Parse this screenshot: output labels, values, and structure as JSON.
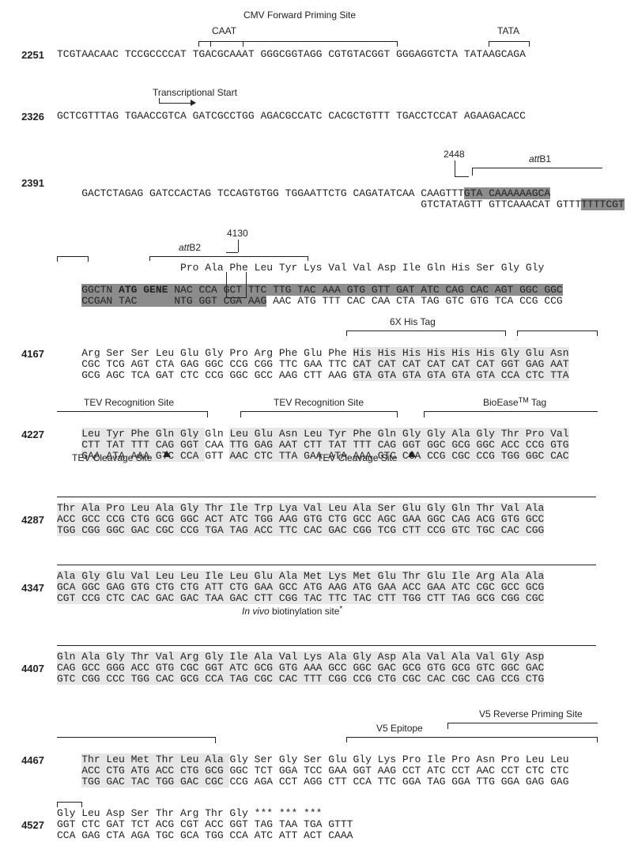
{
  "annotations": {
    "cmv_fwd": "CMV Forward Priming Site",
    "caat": "CAAT",
    "tata": "TATA",
    "tx_start": "Transcriptional Start",
    "attB1": "attB1",
    "attB2": "attB2",
    "pos2448": "2448",
    "pos4130": "4130",
    "atg_gene": "ATG GENE",
    "his_tag": "6X His Tag",
    "tev_rec": "TEV Recognition Site",
    "tev_cleave": "TEV Cleavage Site",
    "bioease": "BioEase",
    "bioease_tm": "TM",
    "bioease_tag": " Tag",
    "in_vivo": "In vivo",
    "in_vivo_rest": " biotinylation site",
    "v5_epitope": "V5 Epitope",
    "v5_rev": "V5 Reverse Priming Site"
  },
  "blocks": [
    {
      "num": "2251",
      "top": "TCGTAACAAC TCCGCCCCAT TGACGCAAAT GGGCGGTAGG CGTGTACGGT GGGAGGTCTA TATAAGCAGA"
    },
    {
      "num": "2326",
      "top": "GCTCGTTTAG TGAACCGTCA GATCGCCTGG AGACGCCATC CACGCTGTTT TGACCTCCAT AGAAGACACC"
    },
    {
      "num": "2391",
      "top": "GACTCTAGAG GATCCACTAG TCCAGTGTGG TGGAATTCTG CAGATATCAA CAAGTTTGTA CAAAAAAGCA",
      "bot": "                                                       GTCTATAGTT GTTCAAACAT GTTTTTTTCGT"
    },
    {
      "num": "",
      "aa": "                    Pro Ala Phe Leu Tyr Lys Val Val Asp Ile Gln His Ser Gly Gly",
      "top": "GGCTN ATG GENE NAC CCA GCT TTC TTG TAC AAA GTG GTT GAT ATC CAG CAC AGT GGC GGC",
      "bot": "CCGAN TAC      NTG GGT CGA AAG AAC ATG TTT CAC CAA CTA TAG GTC GTG TCA CCG CCG"
    },
    {
      "num": "4167",
      "aa": "Arg Ser Ser Leu Glu Gly Pro Arg Phe Glu Phe His His His His His His Gly Glu Asn",
      "top": "CGC TCG AGT CTA GAG GGC CCG CGG TTC GAA TTC CAT CAT CAT CAT CAT CAT GGT GAG AAT",
      "bot": "GCG AGC TCA GAT CTC CCG GGC GCC AAG CTT AAG GTA GTA GTA GTA GTA GTA CCA CTC TTA"
    },
    {
      "num": "4227",
      "aa": "Leu Tyr Phe Gln Gly Gln Leu Glu Asn Leu Tyr Phe Gln Gly Gly Ala Gly Thr Pro Val",
      "top": "CTT TAT TTT CAG GGT CAA TTG GAG AAT CTT TAT TTT CAG GGT GGC GCG GGC ACC CCG GTG",
      "bot": "GAA ATA AAA GTC CCA GTT AAC CTC TTA GAA ATA AAA GTC CCA CCG CGC CCG TGG GGC CAC"
    },
    {
      "num": "4287",
      "aa": "Thr Ala Pro Leu Ala Gly Thr Ile Trp Lya Val Leu Ala Ser Glu Gly Gln Thr Val Ala",
      "top": "ACC GCC CCG CTG GCG GGC ACT ATC TGG AAG GTG CTG GCC AGC GAA GGC CAG ACG GTG GCC",
      "bot": "TGG CGG GGC GAC CGC CCG TGA TAG ACC TTC CAC GAC CGG TCG CTT CCG GTC TGC CAC CGG"
    },
    {
      "num": "4347",
      "aa": "Ala Gly Glu Val Leu Leu Ile Leu Glu Ala Met Lys Met Glu Thr Glu Ile Arg Ala Ala",
      "top": "GCA GGC GAG GTG CTG CTG ATT CTG GAA GCC ATG AAG ATG GAA ACC GAA ATC CGC GCC GCG",
      "bot": "CGT CCG CTC CAC GAC GAC TAA GAC CTT CGG TAC TTC TAC CTT TGG CTT TAG GCG CGG CGC"
    },
    {
      "num": "4407",
      "aa": "Gln Ala Gly Thr Val Arg Gly Ile Ala Val Lys Ala Gly Asp Ala Val Ala Val Gly Asp",
      "top": "CAG GCC GGG ACC GTG CGC GGT ATC GCG GTG AAA GCC GGC GAC GCG GTG GCG GTC GGC GAC",
      "bot": "GTC CGG CCC TGG CAC GCG CCA TAG CGC CAC TTT CGG CCG CTG CGC CAC CGC CAG CCG CTG"
    },
    {
      "num": "4467",
      "aa": "Thr Leu Met Thr Leu Ala Gly Ser Gly Ser Glu Gly Lys Pro Ile Pro Asn Pro Leu Leu",
      "top": "ACC CTG ATG ACC CTG GCG GGC TCT GGA TCC GAA GGT AAG CCT ATC CCT AAC CCT CTC CTC",
      "bot": "TGG GAC TAC TGG GAC CGC CCG AGA CCT AGG CTT CCA TTC GGA TAG GGA TTG GGA GAG GAG"
    },
    {
      "num": "4527",
      "aa": "Gly Leu Asp Ser Thr Arg Thr Gly *** *** ***",
      "top": "GGT CTC GAT TCT ACG CGT ACC GGT TAG TAA TGA GTTT",
      "bot": "CCA GAG CTA AGA TGC GCA TGG CCA ATC ATT ACT CAAA"
    }
  ]
}
